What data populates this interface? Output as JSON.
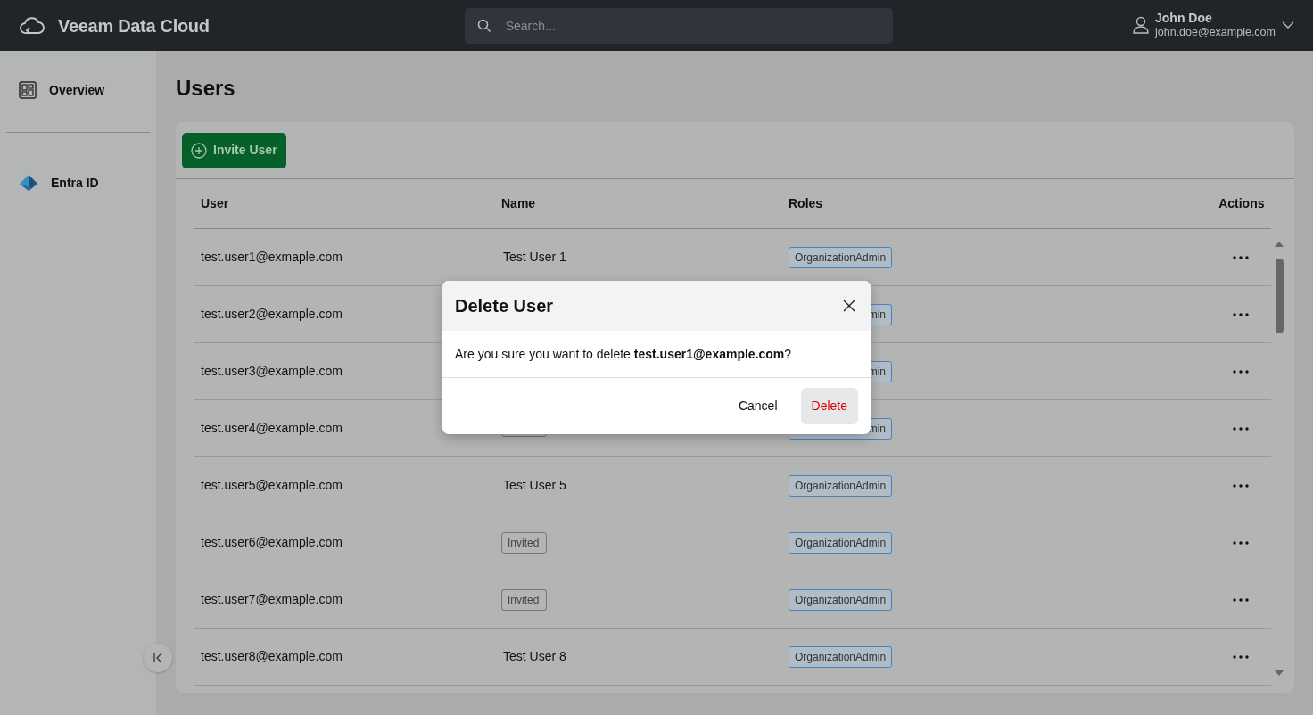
{
  "header": {
    "brand": "Veeam Data Cloud",
    "search": {
      "placeholder": "Search..."
    },
    "user": {
      "name": "John Doe",
      "email": "john.doe@example.com"
    }
  },
  "sidebar": {
    "items": [
      {
        "label": "Overview",
        "kind": "grid"
      },
      {
        "label": "Entra ID",
        "kind": "entra"
      }
    ]
  },
  "page": {
    "title": "Users",
    "invite_button": "Invite User"
  },
  "table": {
    "columns": [
      "User",
      "Name",
      "Roles",
      "Actions"
    ],
    "rows": [
      {
        "user": "test.user1@exmaple.com",
        "name": {
          "kind": "text",
          "label": "Test User 1"
        },
        "role": "OrganizationAdmin"
      },
      {
        "user": "test.user2@example.com",
        "role": "min"
      },
      {
        "user": "test.user3@example.com",
        "role": "min"
      },
      {
        "user": "test.user4@example.com",
        "name": {
          "kind": "badge"
        },
        "role": "min"
      },
      {
        "user": "test.user5@example.com",
        "name": {
          "kind": "text",
          "label": "Test User 5"
        },
        "role": "OrganizationAdmin"
      },
      {
        "user": "test.user6@example.com",
        "name": {
          "kind": "badge",
          "label": "Invited"
        },
        "role": "OrganizationAdmin"
      },
      {
        "user": "test.user7@exmaple.com",
        "name": {
          "kind": "badge",
          "label": "Invited"
        },
        "role": "OrganizationAdmin"
      },
      {
        "user": "test.user8@example.com",
        "name": {
          "kind": "text",
          "label": "Test User 8"
        },
        "role": "OrganizationAdmin"
      }
    ]
  },
  "dialog": {
    "title": "Delete User",
    "message": "Are you sure you want to delete **test.user1@example.com**?",
    "buttons": [
      {
        "label": "Cancel",
        "kind": "plain"
      },
      {
        "label": "Delete",
        "kind": "danger"
      }
    ]
  }
}
